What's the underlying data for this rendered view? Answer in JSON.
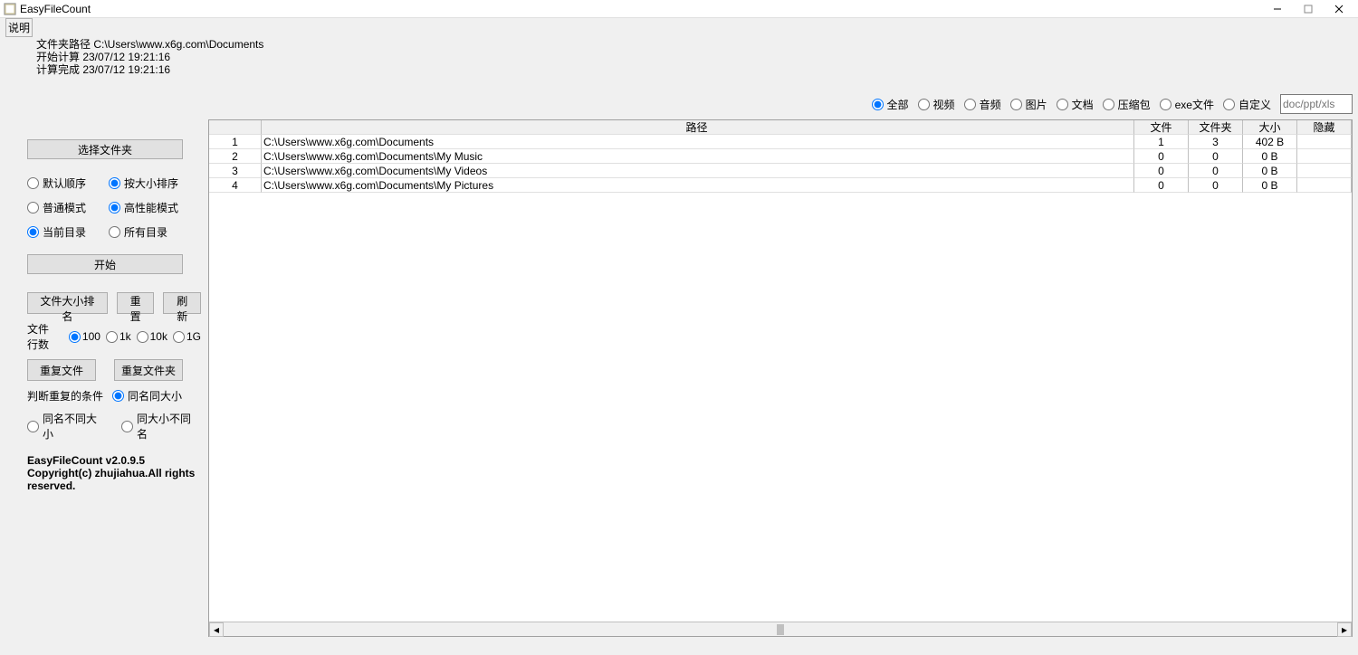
{
  "app": {
    "title": "EasyFileCount"
  },
  "menu": {
    "help": "说明"
  },
  "info": {
    "line1": "文件夹路径 C:\\Users\\www.x6g.com\\Documents",
    "line2": "开始计算 23/07/12 19:21:16",
    "line3": "计算完成 23/07/12 19:21:16"
  },
  "left": {
    "select_folder": "选择文件夹",
    "sort_default": "默认顺序",
    "sort_size": "按大小排序",
    "mode_normal": "普通模式",
    "mode_perf": "高性能模式",
    "dir_current": "当前目录",
    "dir_all": "所有目录",
    "start": "开始",
    "sort_files": "文件大小排名",
    "reset": "重置",
    "refresh": "刷新",
    "file_rows_label": "文件行数",
    "rows_100": "100",
    "rows_1k": "1k",
    "rows_10k": "10k",
    "rows_1g": "1G",
    "dup_files": "重复文件",
    "dup_folders": "重复文件夹",
    "dup_cond_label": "判断重复的条件",
    "dup_same_name_size": "同名同大小",
    "dup_same_name_diff_size": "同名不同大小",
    "dup_same_size_diff_name": "同大小不同名",
    "version": "EasyFileCount v2.0.9.5",
    "copyright": "Copyright(c) zhujiahua.All rights reserved."
  },
  "filters": {
    "all": "全部",
    "video": "视频",
    "audio": "音频",
    "image": "图片",
    "doc": "文档",
    "archive": "压缩包",
    "exe": "exe文件",
    "custom": "自定义",
    "custom_placeholder": "doc/ppt/xls"
  },
  "table": {
    "cols": {
      "path": "路径",
      "file": "文件",
      "folder": "文件夹",
      "size": "大小",
      "hidden": "隐藏"
    },
    "rows": [
      {
        "n": "1",
        "path": "C:\\Users\\www.x6g.com\\Documents",
        "file": "1",
        "folder": "3",
        "size": "402 B",
        "hidden": ""
      },
      {
        "n": "2",
        "path": "C:\\Users\\www.x6g.com\\Documents\\My Music",
        "file": "0",
        "folder": "0",
        "size": "0 B",
        "hidden": ""
      },
      {
        "n": "3",
        "path": "C:\\Users\\www.x6g.com\\Documents\\My Videos",
        "file": "0",
        "folder": "0",
        "size": "0 B",
        "hidden": ""
      },
      {
        "n": "4",
        "path": "C:\\Users\\www.x6g.com\\Documents\\My Pictures",
        "file": "0",
        "folder": "0",
        "size": "0 B",
        "hidden": ""
      }
    ]
  }
}
